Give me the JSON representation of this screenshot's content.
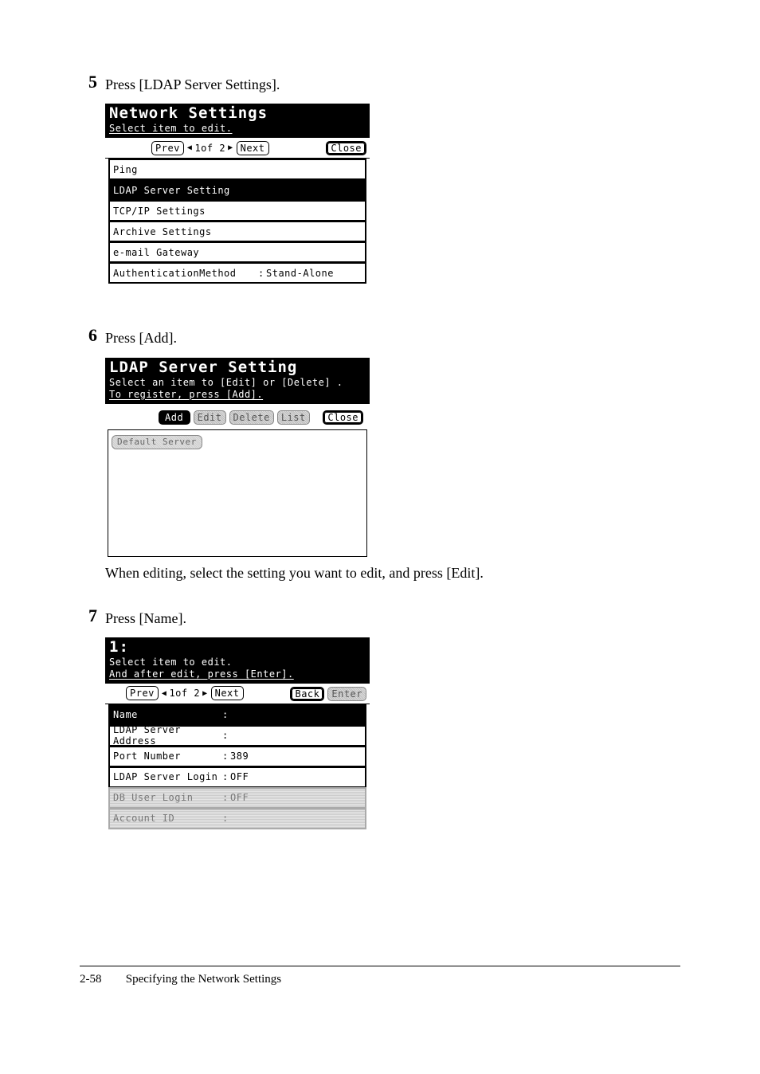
{
  "steps": {
    "s5": {
      "num": "5",
      "text": "Press [LDAP Server Settings]."
    },
    "s6": {
      "num": "6",
      "text": "Press [Add].",
      "note": "When editing, select the setting you want to edit, and press [Edit]."
    },
    "s7": {
      "num": "7",
      "text": "Press [Name]."
    }
  },
  "screenA": {
    "title": "Network Settings",
    "subtitle": "Select item to edit.",
    "prev": "Prev",
    "pager": "1of  2",
    "next": "Next",
    "close": "Close",
    "rows": {
      "r0": {
        "lbl": "Ping"
      },
      "r1": {
        "lbl": "LDAP Server Setting"
      },
      "r2": {
        "lbl": "TCP/IP Settings"
      },
      "r3": {
        "lbl": "Archive Settings"
      },
      "r4": {
        "lbl": "e-mail Gateway"
      },
      "r5": {
        "lbl": "AuthenticationMethod",
        "val": "Stand-Alone"
      }
    }
  },
  "screenB": {
    "title": "LDAP Server Setting",
    "sub1": "Select an item to [Edit] or [Delete] .",
    "sub2": "To register, press  [Add].",
    "add": "Add",
    "edit": "Edit",
    "delete": "Delete",
    "list": "List",
    "close": "Close",
    "default": "Default Server"
  },
  "screenC": {
    "title": "1:",
    "sub1": "Select item to edit.",
    "sub2": "And after edit, press [Enter].",
    "prev": "Prev",
    "pager": "1of  2",
    "next": "Next",
    "back": "Back",
    "enter": "Enter",
    "rows": {
      "r0": {
        "lbl": "Name",
        "val": ""
      },
      "r1": {
        "lbl": "LDAP Server Address",
        "val": ""
      },
      "r2": {
        "lbl": "Port Number",
        "val": "389"
      },
      "r3": {
        "lbl": "LDAP Server Login",
        "val": "OFF"
      },
      "r4": {
        "lbl": "DB User Login",
        "val": "OFF"
      },
      "r5": {
        "lbl": "Account ID",
        "val": ""
      }
    }
  },
  "footer": {
    "page": "2-58",
    "chapter": "Specifying the Network Settings"
  }
}
